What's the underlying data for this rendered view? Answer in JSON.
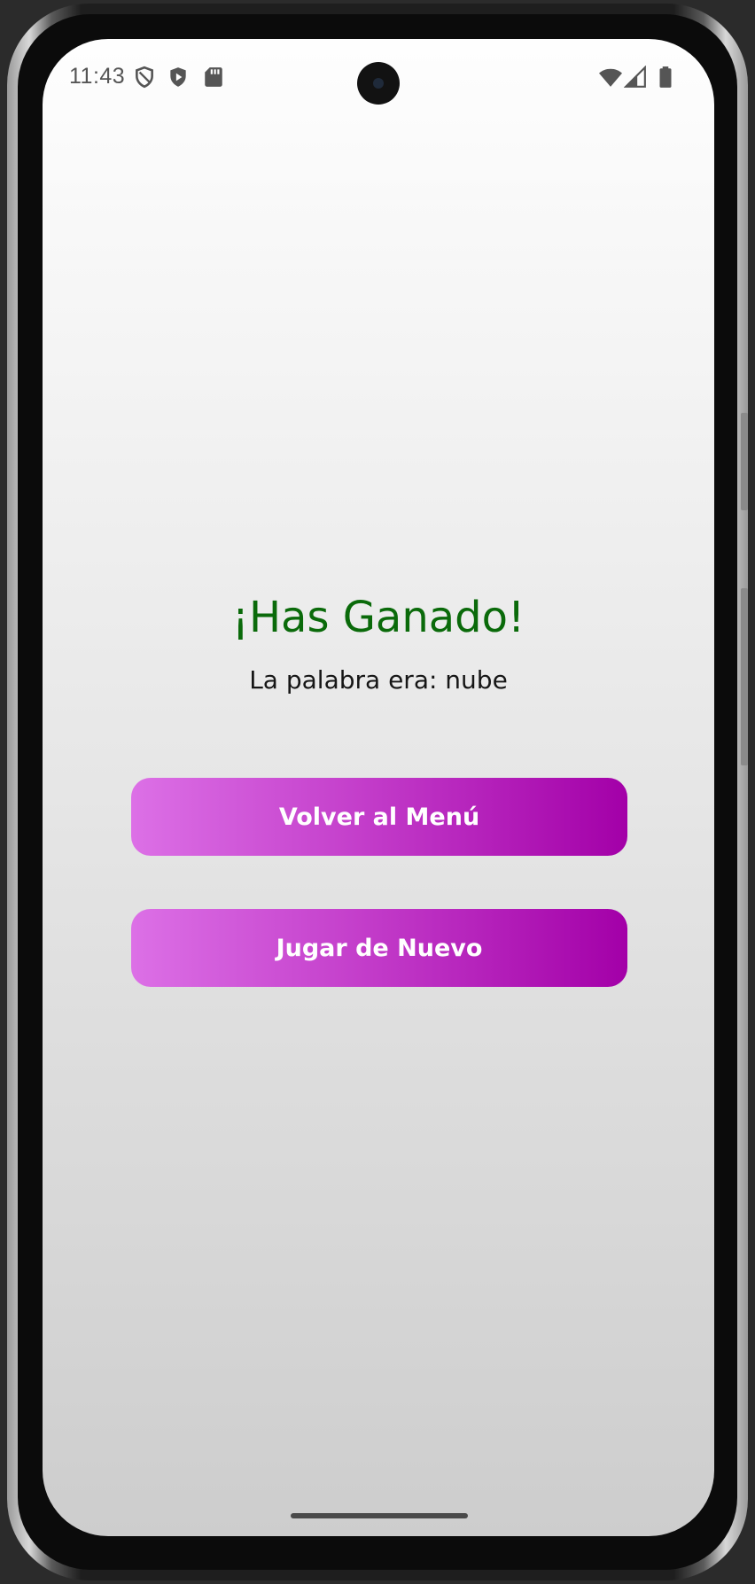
{
  "status_bar": {
    "time": "11:43",
    "left_icons": [
      "shield-outline-icon",
      "shield-play-icon",
      "sd-card-icon"
    ],
    "right_icons": [
      "wifi-icon",
      "cell-signal-icon",
      "battery-icon"
    ]
  },
  "result": {
    "title": "¡Has Ganado!",
    "subtitle": "La palabra era: nube"
  },
  "buttons": {
    "menu_label": "Volver al Menú",
    "again_label": "Jugar de Nuevo"
  },
  "colors": {
    "title": "#0a6a0a",
    "button_gradient_start": "#dc70e6",
    "button_gradient_end": "#a300a8",
    "button_text": "#ffffff"
  }
}
